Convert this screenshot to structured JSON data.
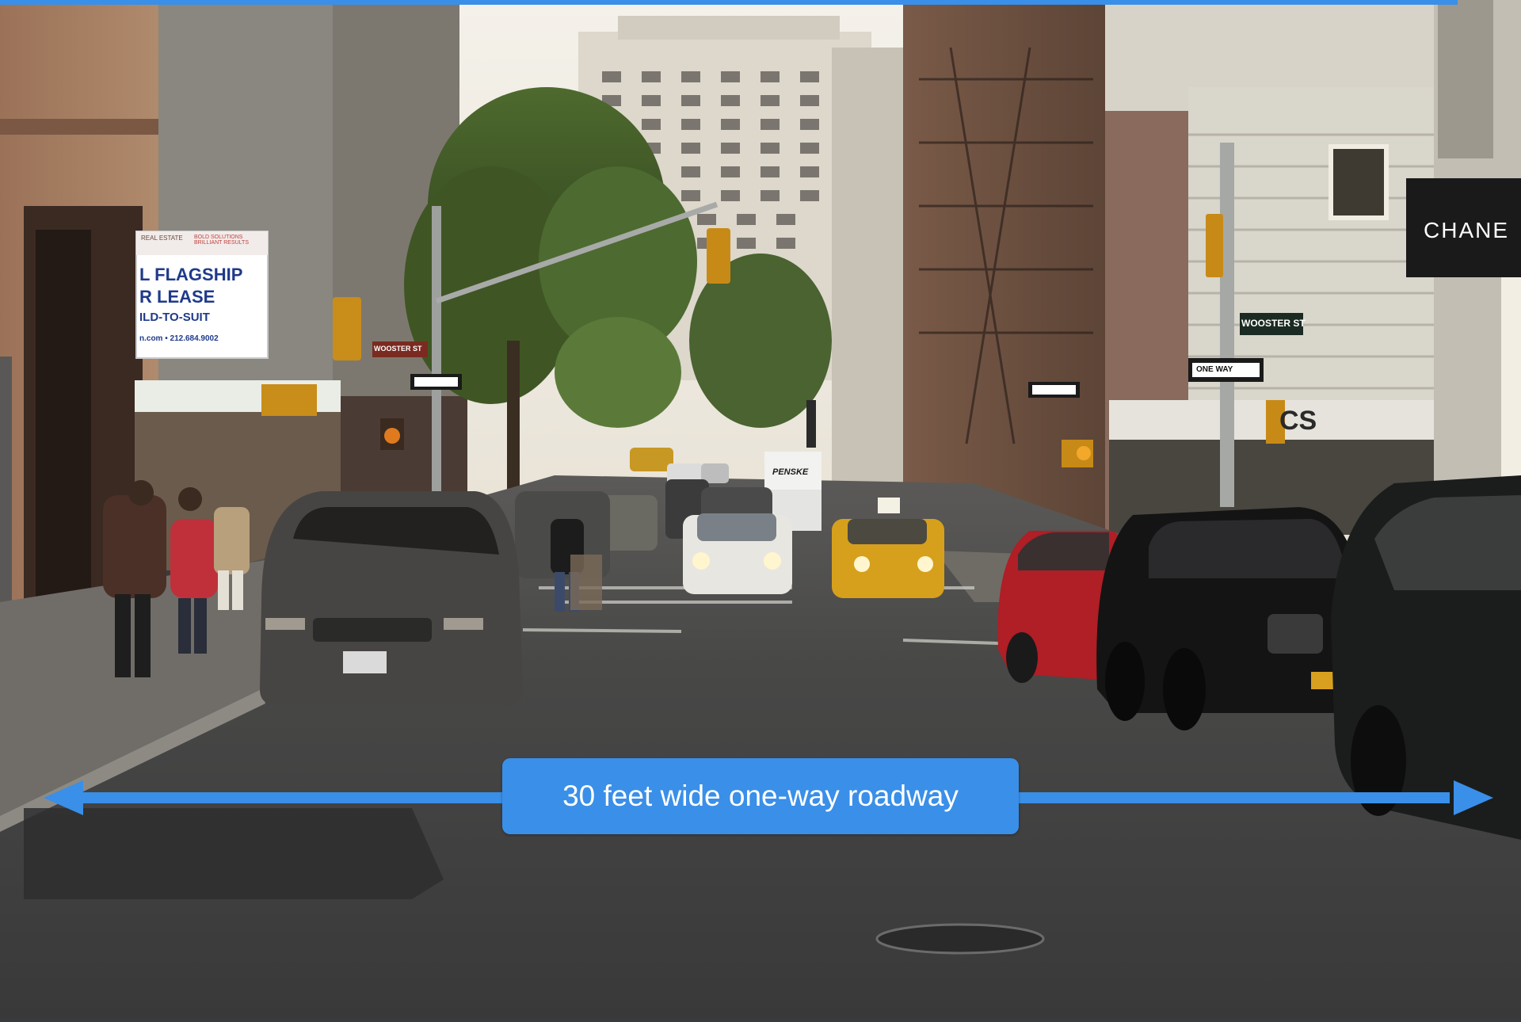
{
  "annotation": {
    "label": "30 feet wide one-way roadway",
    "accent_color": "#3a8fe8"
  },
  "signs": {
    "billboard_line1": "L FLAGSHIP",
    "billboard_line2": "R LEASE",
    "billboard_line3": "ILD-TO-SUIT",
    "billboard_contact": "n.com • 212.684.9002",
    "billboard_top_left": "REAL ESTATE",
    "billboard_top_right": "BOLD SOLUTIONS BRILLIANT RESULTS",
    "street_sign": "WOOSTER ST",
    "street_sign_left": "WOOSTER ST",
    "one_way": "ONE WAY",
    "chanel": "CHANE",
    "store_name": "CS",
    "truck": "PENSKE"
  }
}
